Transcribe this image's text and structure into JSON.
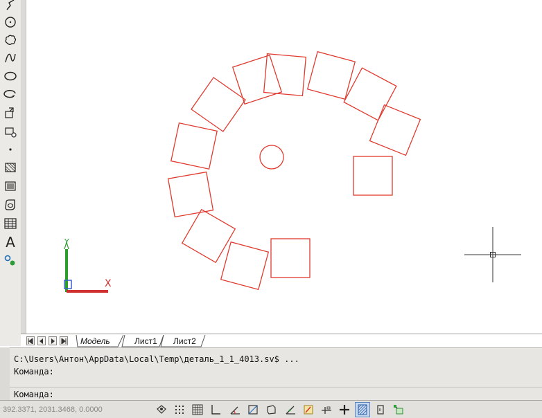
{
  "tabs": {
    "model": "Модель",
    "sheet1": "Лист1",
    "sheet2": "Лист2"
  },
  "toolbar": {
    "text_tool_glyph": "A",
    "icons": [
      "polyline-icon",
      "circle-icon",
      "revision-cloud-icon",
      "spline-icon",
      "ellipse-icon",
      "ellipse-arc-icon",
      "insert-block-icon",
      "make-block-icon",
      "point-icon",
      "hatch-icon",
      "gradient-icon",
      "region-icon",
      "table-icon",
      "multiline-text-icon",
      "add-selected-icon"
    ]
  },
  "command": {
    "line1": "C:\\Users\\Антон\\AppData\\Local\\Temp\\деталь_1_1_4013.sv$ ...",
    "line2": "Команда:",
    "prompt": "Команда:"
  },
  "status": {
    "coordinates": "392.3371, 2031.3468, 0.0000",
    "active_toggles": [
      "grid-display",
      "lineweight"
    ]
  },
  "ucs": {
    "y_label": "Y",
    "x_label": "X"
  },
  "colors": {
    "geometry": "#e03a2e",
    "ucs_y": "#2aa02a",
    "ucs_x": "#d03030",
    "crosshair": "#333333",
    "background": "#ffffff"
  }
}
